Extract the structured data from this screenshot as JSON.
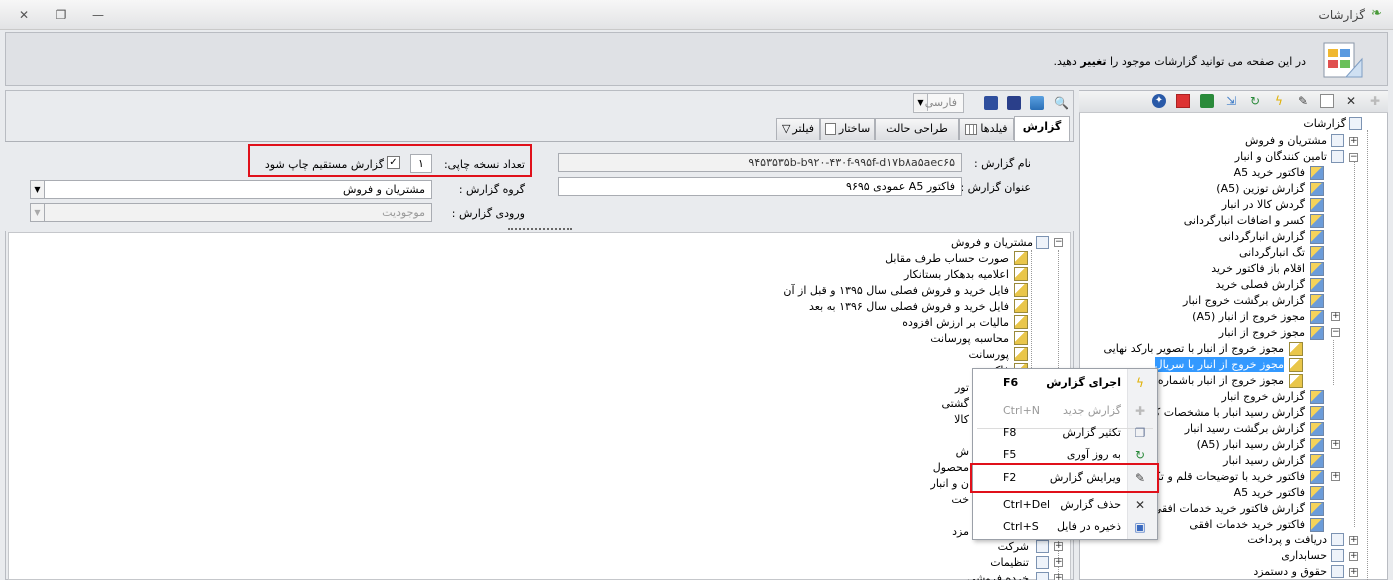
{
  "window": {
    "title": "گزارشات",
    "close": "✕",
    "restore": "❐",
    "minimize": "—"
  },
  "info": {
    "part1": "در این صفحه می توانید گزارشات موجود را ",
    "bold": "تغییر",
    "part2": " دهید."
  },
  "language": "فارسی",
  "tabs": [
    {
      "label": "گزارش",
      "name": "tab-report"
    },
    {
      "label": "فیلدها",
      "name": "tab-fields"
    },
    {
      "label": "طراحی حالت پویا",
      "name": "tab-dynamic-design"
    },
    {
      "label": "ساختار",
      "name": "tab-structure"
    },
    {
      "label": "فیلتر",
      "name": "tab-filter"
    }
  ],
  "form": {
    "name_label": "نام گزارش :",
    "name_value": "۹۴۵۳۵۳۵b-b۹۲۰-۴۳۰f-۹۹۵f-d۱۷b۸a۵aec۶۵",
    "title_label": "عنوان گزارش :",
    "title_value": "فاکتور  A5 عمودی ۹۶۹۵",
    "copies_label": "تعداد نسخه چاپی:",
    "copies_value": "۱",
    "direct_print_label": "گزارش مستقیم چاپ شود",
    "group_label": "گروه گزارش :",
    "group_value": "مشتریان و فروش",
    "input_label": "ورودی گزارش :",
    "input_value": "موجودیت"
  },
  "mid_tree": {
    "root": "مشتریان و فروش",
    "items": [
      "صورت حساب طرف مقابل",
      "اعلامیه بدهکار بستانکار",
      "فایل خرید و فروش فصلی سال ۱۳۹۵ و قبل از آن",
      "فایل خرید و فروش فصلی سال ۱۳۹۶ به بعد",
      "مالیات بر ارزش افزوده",
      "محاسبه پورسانت",
      "پورسانت",
      "فاکتور"
    ],
    "partials": [
      "تور",
      "گشتی",
      "کالا",
      "ش",
      "محصول",
      "ن و انبار",
      "خت",
      "مزد"
    ],
    "bottom": [
      "شرکت",
      "تنظیمات",
      "خرده فروشی"
    ]
  },
  "context_menu": [
    {
      "label": "اجرای گزارش",
      "key": "F6",
      "icon": "lightning-icon",
      "bold": true,
      "disabled": false
    },
    {
      "label": "گزارش جدید",
      "key": "Ctrl+N",
      "icon": "plus-icon",
      "bold": false,
      "disabled": true
    },
    {
      "label": "تکثیر گزارش",
      "key": "F8",
      "icon": "copy-icon",
      "bold": false,
      "disabled": false
    },
    {
      "label": "به روز آوری",
      "key": "F5",
      "icon": "refresh-icon",
      "bold": false,
      "disabled": false
    },
    {
      "label": "ویرایش گزارش",
      "key": "F2",
      "icon": "edit-icon",
      "bold": false,
      "disabled": false
    },
    {
      "label": "حذف گزارش",
      "key": "Ctrl+Del",
      "icon": "delete-icon",
      "bold": false,
      "disabled": false
    },
    {
      "label": "ذخیره در فایل",
      "key": "Ctrl+S",
      "icon": "save-file-icon",
      "bold": false,
      "disabled": false
    }
  ],
  "right_tree": {
    "root": "گزارشات",
    "level1_top": [
      "مشتریان و فروش",
      "تامین کنندگان و انبار"
    ],
    "items": [
      "فاکتور خرید A5",
      "گزارش توزین (A5)",
      "گردش کالا در انبار",
      "کسر و اضافات انبارگردانی",
      "گزارش انبارگردانی",
      "تگ انبارگردانی",
      "اقلام باز فاکتور خرید",
      "گزارش فصلی خرید",
      "گزارش برگشت خروج انبار",
      "مجوز خروج از انبار (A5)",
      "مجوز خروج از انبار"
    ],
    "sub": [
      "مجوز خروج از انبار با تصویر بارکد نهایی",
      "مجوز خروج از انبار با سریال",
      "مجوز خروج از انبار باشماره فاکتور"
    ],
    "items2": [
      "گزارش خروج انبار",
      "گزارش رسید انبار با مشخصات کالا",
      "گزارش برگشت رسید انبار",
      "گزارش رسید انبار (A5)",
      "گزارش رسید انبار",
      "فاکتور خرید با توضیحات قلم و تکرار",
      "فاکتور خرید A5",
      "گزارش فاکتور خرید خدمات افقی",
      "فاکتور خرید خدمات افقی"
    ],
    "level1_bottom": [
      "دریافت و پرداخت",
      "حسابداری",
      "حقوق و دستمزد"
    ]
  }
}
